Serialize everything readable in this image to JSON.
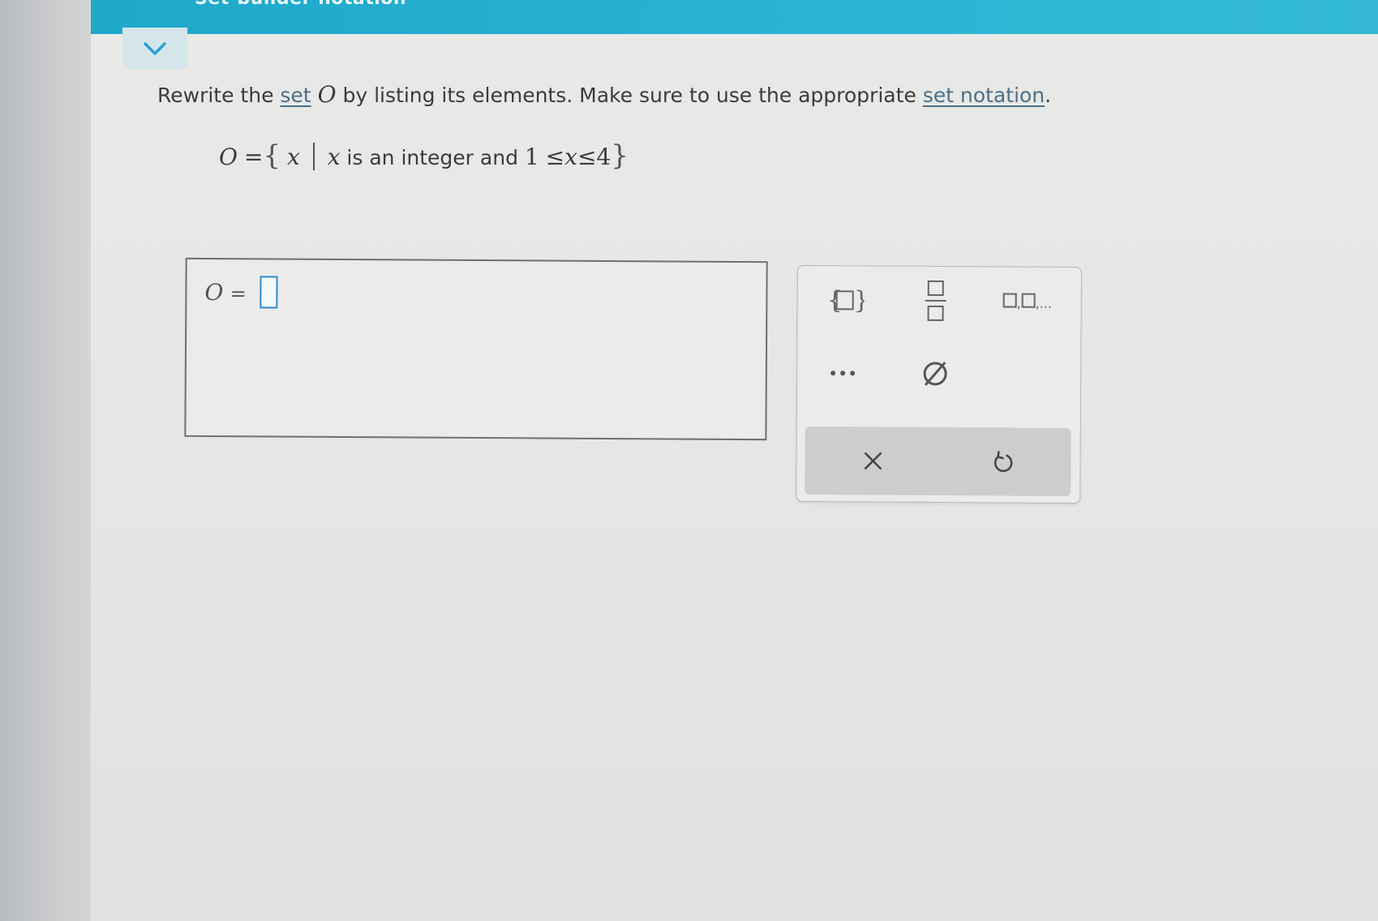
{
  "header": {
    "title": "Set-builder notation"
  },
  "question": {
    "prefix": "Rewrite the ",
    "set_link": "set",
    "set_name": "O",
    "middle": " by listing its elements. Make sure to use the appropriate ",
    "notation_link": "set notation",
    "suffix": "."
  },
  "set_definition": {
    "lhs": "O",
    "equals": "=",
    "open_brace": "{",
    "var": "x",
    "var2": "x",
    "text": " is an integer and ",
    "lower": "1",
    "le1": "≤",
    "var3": "x",
    "le2": "≤",
    "upper": "4",
    "close_brace": "}"
  },
  "answer": {
    "label_var": "O",
    "label_eq": "="
  },
  "keypad": {
    "icons": {
      "set_braces": "set-braces-icon",
      "fraction": "fraction-icon",
      "list": "list-icon",
      "ellipsis": "ellipsis-icon",
      "empty_set": "empty-set-icon",
      "clear": "clear-icon",
      "undo": "undo-icon"
    },
    "list_text": "□,□,...",
    "ellipsis_text": "...",
    "empty_set_text": "∅"
  },
  "colors": {
    "header": "#2bb4d4",
    "link": "#4a6f8a",
    "slot_border": "#2b8bd0"
  }
}
